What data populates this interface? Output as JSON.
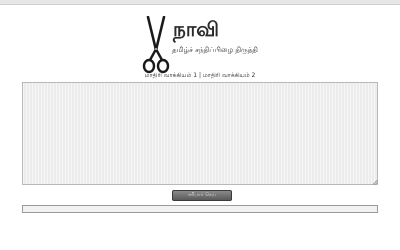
{
  "header": {
    "title": "நாவி",
    "tagline": "தமிழ்ச் சந்திப்பிழை திருத்தி",
    "logo_icon": "scissors-icon"
  },
  "editor": {
    "example_text": "மாதிரி வாக்கியம் 1 | மாதிரி வாக்கியம் 2",
    "value": "",
    "placeholder": ""
  },
  "actions": {
    "check_label": "சரிபார் செய்"
  },
  "colors": {
    "background": "#ffffff",
    "textarea_bg": "#ececec",
    "button_bg": "#6e6e6e",
    "button_text": "#dcdcdc"
  }
}
